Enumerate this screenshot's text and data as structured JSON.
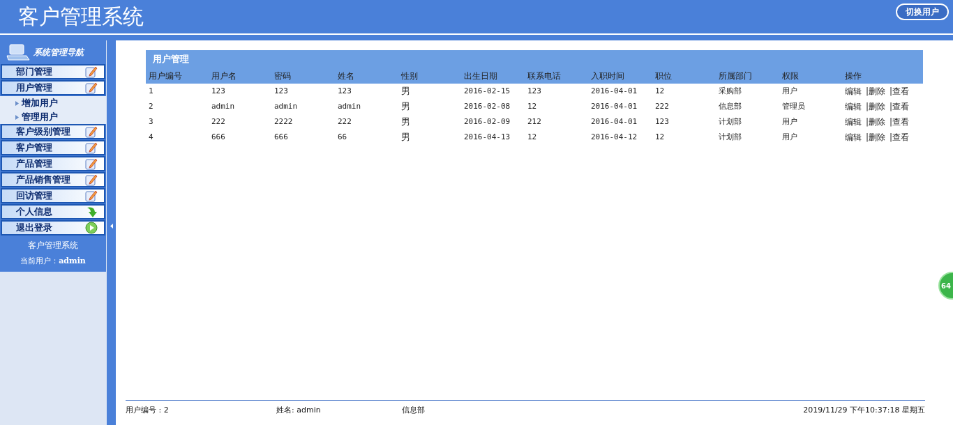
{
  "header": {
    "title": "客户管理系统",
    "switch_user": "切换用户"
  },
  "sidebar": {
    "title": "系统管理导航",
    "items": [
      {
        "label": "部门管理",
        "kind": "menu"
      },
      {
        "label": "用户管理",
        "kind": "menu"
      },
      {
        "label": "增加用户",
        "kind": "submenu"
      },
      {
        "label": "管理用户",
        "kind": "submenu"
      },
      {
        "label": "客户级别管理",
        "kind": "menu"
      },
      {
        "label": "客户管理",
        "kind": "menu"
      },
      {
        "label": "产品管理",
        "kind": "menu"
      },
      {
        "label": "产品销售管理",
        "kind": "menu"
      },
      {
        "label": "回访管理",
        "kind": "menu"
      },
      {
        "label": "个人信息",
        "kind": "profile"
      },
      {
        "label": "退出登录",
        "kind": "logout"
      }
    ],
    "footer_title": "客户管理系统",
    "current_user_label": "当前用户：",
    "current_user": "admin"
  },
  "panel": {
    "title": "用户管理",
    "columns": [
      "用户编号",
      "用户名",
      "密码",
      "姓名",
      "性别",
      "出生日期",
      "联系电话",
      "入职时间",
      "职位",
      "所属部门",
      "权限",
      "操作"
    ],
    "rows": [
      {
        "cells": [
          "1",
          "123",
          "123",
          "123",
          "男",
          "2016-02-15",
          "123",
          "2016-04-01",
          "12",
          "采购部",
          "用户"
        ],
        "actions": [
          "编辑",
          "|删除",
          "|查看"
        ]
      },
      {
        "cells": [
          "2",
          "admin",
          "admin",
          "admin",
          "男",
          "2016-02-08",
          "12",
          "2016-04-01",
          "222",
          "信息部",
          "管理员"
        ],
        "actions": [
          "编辑",
          "|删除",
          "|查看"
        ]
      },
      {
        "cells": [
          "3",
          "222",
          "2222",
          "222",
          "男",
          "2016-02-09",
          "212",
          "2016-04-01",
          "123",
          "计划部",
          "用户"
        ],
        "actions": [
          "编辑",
          "|删除",
          "|查看"
        ]
      },
      {
        "cells": [
          "4",
          "666",
          "666",
          "66",
          "男",
          "2016-04-13",
          "12",
          "2016-04-12",
          "12",
          "计划部",
          "用户"
        ],
        "actions": [
          "编辑",
          "|删除",
          "|查看"
        ]
      }
    ]
  },
  "status_bar": {
    "user_id": "用户编号 : 2",
    "name": "姓名: admin",
    "department": "信息部",
    "datetime": "2019/11/29 下午10:37:18 星期五"
  },
  "floating_badge": "64"
}
